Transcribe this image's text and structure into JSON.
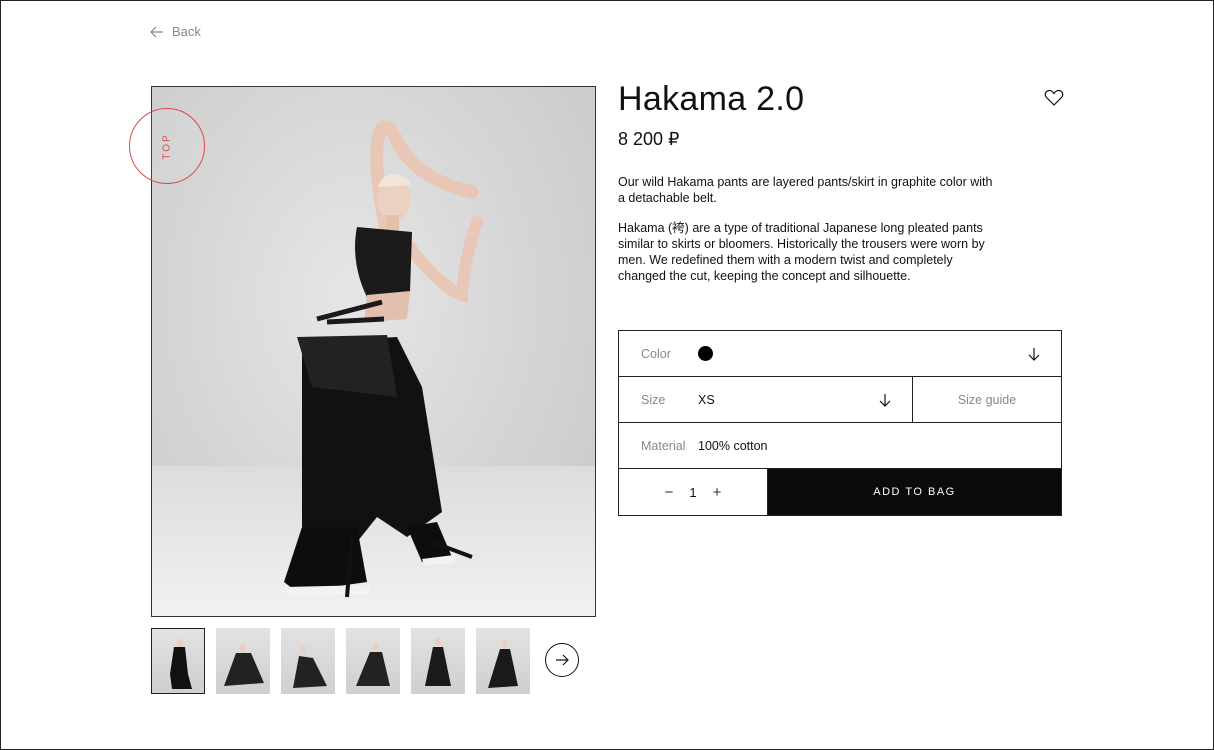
{
  "nav": {
    "back_label": "Back"
  },
  "badge": {
    "label": "TOP",
    "color": "#d94a4a"
  },
  "product": {
    "title": "Hakama 2.0",
    "price": "8 200 ₽",
    "description": [
      "Our wild Hakama pants are layered pants/skirt in graphite color with a detachable belt.",
      "Hakama (袴) are a type of traditional Japanese long pleated pants similar to skirts or bloomers. Historically the trousers were worn by men. We redefined them with a modern twist and completely changed the cut, keeping the concept and silhouette."
    ]
  },
  "options": {
    "color_label": "Color",
    "color_value": "#000000",
    "size_label": "Size",
    "size_value": "XS",
    "size_guide_label": "Size guide",
    "material_label": "Material",
    "material_value": "100% cotton",
    "quantity": "1",
    "minus_symbol": "−",
    "plus_symbol": "+",
    "add_to_bag_label": "ADD TO BAG"
  },
  "gallery": {
    "thumbnail_count": 6,
    "active_index": 0
  },
  "icons": [
    "arrow-left-icon",
    "heart-icon",
    "arrow-down-icon",
    "arrow-right-icon"
  ]
}
